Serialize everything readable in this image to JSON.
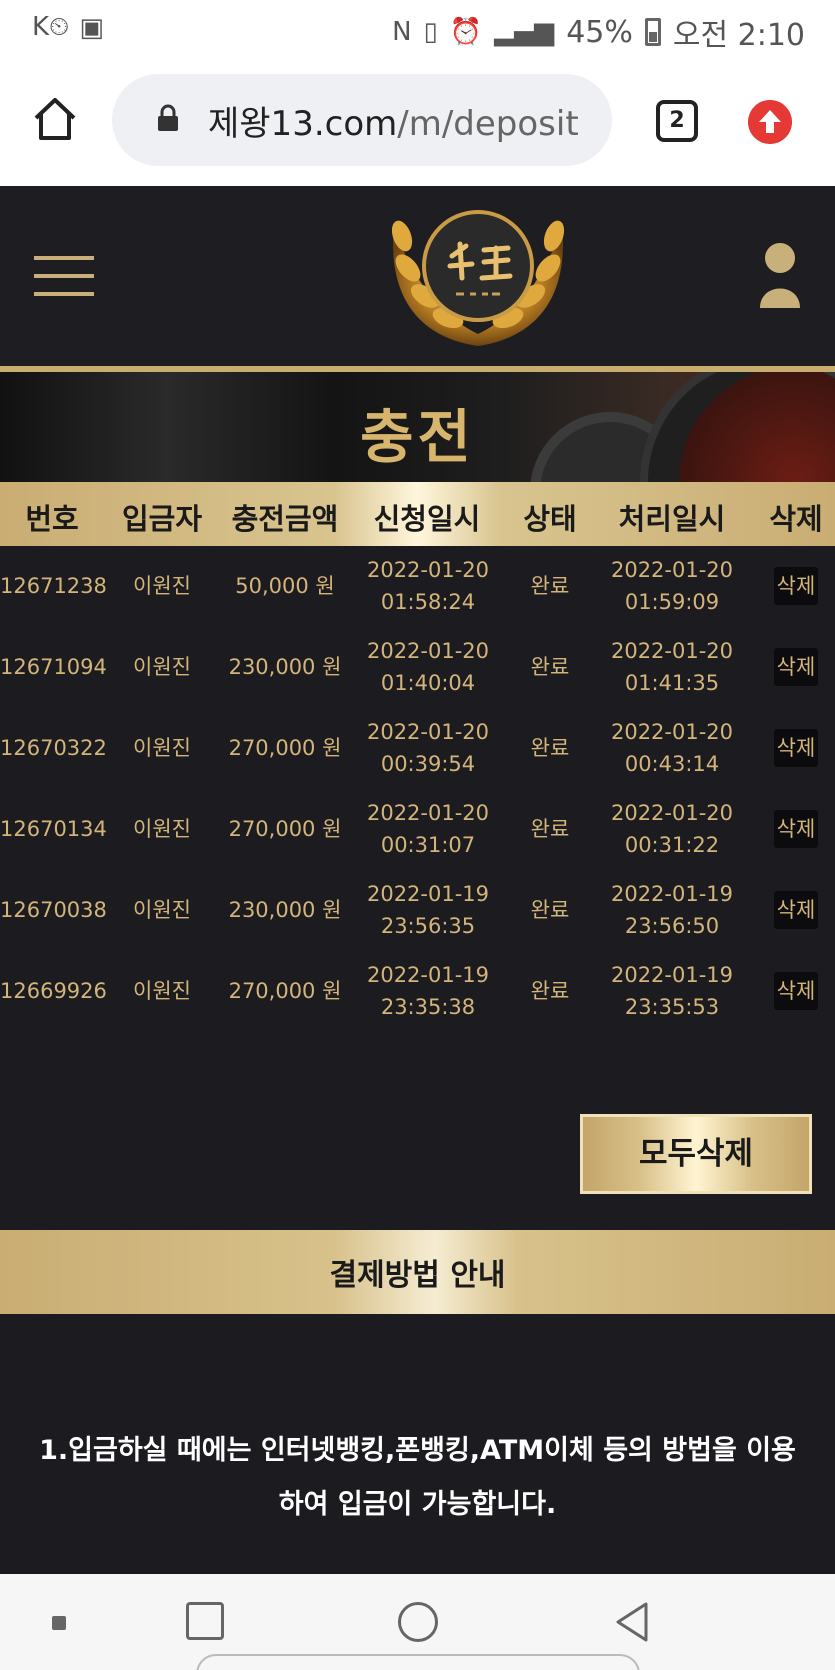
{
  "status_bar": {
    "battery": "45%",
    "time": "오전 2:10"
  },
  "browser": {
    "url_host": "제왕13.com",
    "url_path": "/m/deposit",
    "tab_count": "2"
  },
  "page": {
    "title": "충전"
  },
  "table": {
    "headers": [
      "번호",
      "입금자",
      "충전금액",
      "신청일시",
      "상태",
      "처리일시",
      "삭제"
    ],
    "rows": [
      {
        "id": "12671238",
        "depositor": "이원진",
        "amount": "50,000 원",
        "req_date": "2022-01-20",
        "req_time": "01:58:24",
        "status": "완료",
        "proc_date": "2022-01-20",
        "proc_time": "01:59:09",
        "delete": "삭제"
      },
      {
        "id": "12671094",
        "depositor": "이원진",
        "amount": "230,000 원",
        "req_date": "2022-01-20",
        "req_time": "01:40:04",
        "status": "완료",
        "proc_date": "2022-01-20",
        "proc_time": "01:41:35",
        "delete": "삭제"
      },
      {
        "id": "12670322",
        "depositor": "이원진",
        "amount": "270,000 원",
        "req_date": "2022-01-20",
        "req_time": "00:39:54",
        "status": "완료",
        "proc_date": "2022-01-20",
        "proc_time": "00:43:14",
        "delete": "삭제"
      },
      {
        "id": "12670134",
        "depositor": "이원진",
        "amount": "270,000 원",
        "req_date": "2022-01-20",
        "req_time": "00:31:07",
        "status": "완료",
        "proc_date": "2022-01-20",
        "proc_time": "00:31:22",
        "delete": "삭제"
      },
      {
        "id": "12670038",
        "depositor": "이원진",
        "amount": "230,000 원",
        "req_date": "2022-01-19",
        "req_time": "23:56:35",
        "status": "완료",
        "proc_date": "2022-01-19",
        "proc_time": "23:56:50",
        "delete": "삭제"
      },
      {
        "id": "12669926",
        "depositor": "이원진",
        "amount": "270,000 원",
        "req_date": "2022-01-19",
        "req_time": "23:35:38",
        "status": "완료",
        "proc_date": "2022-01-19",
        "proc_time": "23:35:53",
        "delete": "삭제"
      }
    ],
    "delete_all_label": "모두삭제"
  },
  "guide": {
    "title": "결제방법 안내",
    "text": "1.입금하실 때에는 인터넷뱅킹,폰뱅킹,ATM이체 등의 방법을 이용하여 입금이 가능합니다."
  },
  "colors": {
    "gold": "#c9ad73",
    "gold_text": "#d3b47a",
    "dark_bg": "#1c1c20"
  }
}
